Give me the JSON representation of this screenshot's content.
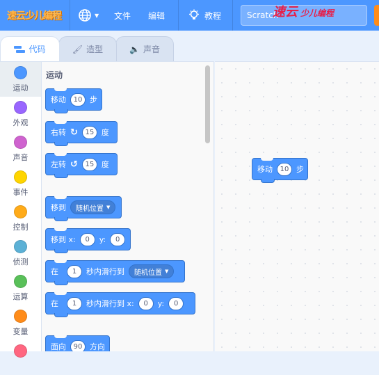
{
  "menubar": {
    "logo_text": "速云少儿编程",
    "file": "文件",
    "edit": "编辑",
    "tutorial": "教程",
    "project_title": "Scratch"
  },
  "watermark": {
    "main": "速云",
    "sub": "少儿编程"
  },
  "tabs": {
    "code": "代码",
    "costume": "造型",
    "sound": "声音"
  },
  "categories": [
    {
      "label": "运动",
      "color": "#4c97ff"
    },
    {
      "label": "外观",
      "color": "#9966ff"
    },
    {
      "label": "声音",
      "color": "#cf63cf"
    },
    {
      "label": "事件",
      "color": "#ffd500"
    },
    {
      "label": "控制",
      "color": "#ffab19"
    },
    {
      "label": "侦测",
      "color": "#5cb1d6"
    },
    {
      "label": "运算",
      "color": "#59c059"
    },
    {
      "label": "变量",
      "color": "#ff8c1a"
    }
  ],
  "palette": {
    "heading": "运动",
    "move": {
      "prefix": "移动",
      "value": "10",
      "suffix": "步"
    },
    "turn_right": {
      "prefix": "右转",
      "value": "15",
      "suffix": "度"
    },
    "turn_left": {
      "prefix": "左转",
      "value": "15",
      "suffix": "度"
    },
    "goto": {
      "prefix": "移到",
      "option": "随机位置"
    },
    "goto_xy": {
      "prefix": "移到 x:",
      "x": "0",
      "ylabel": "y:",
      "y": "0"
    },
    "glide": {
      "prefix": "在",
      "secs": "1",
      "mid": "秒内滑行到",
      "option": "随机位置"
    },
    "glide_xy": {
      "prefix": "在",
      "secs": "1",
      "mid": "秒内滑行到 x:",
      "x": "0",
      "ylabel": "y:",
      "y": "0"
    },
    "point": {
      "prefix": "面向",
      "value": "90",
      "suffix": "方向"
    }
  },
  "script": {
    "move": {
      "prefix": "移动",
      "value": "10",
      "suffix": "步"
    }
  }
}
